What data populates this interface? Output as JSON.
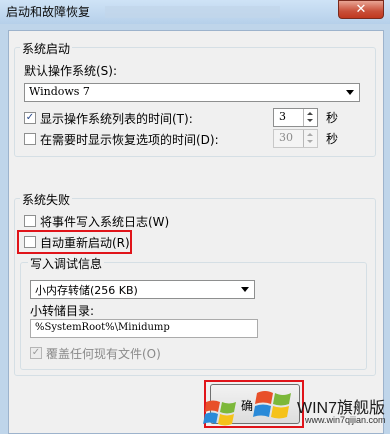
{
  "window": {
    "title": "启动和故障恢复",
    "close_glyph": "✕"
  },
  "startup": {
    "group_title": "系统启动",
    "default_os_label": "默认操作系统(S):",
    "default_os_value": "Windows 7",
    "show_os_list": {
      "label": "显示操作系统列表的时间(T):",
      "checked": true,
      "value": "3",
      "unit": "秒"
    },
    "show_recovery": {
      "label": "在需要时显示恢复选项的时间(D):",
      "checked": false,
      "value": "30",
      "unit": "秒"
    }
  },
  "failure": {
    "group_title": "系统失败",
    "write_event": {
      "label": "将事件写入系统日志(W)",
      "checked": false
    },
    "auto_restart": {
      "label": "自动重新启动(R)",
      "checked": false
    },
    "debug_group_title": "写入调试信息",
    "debug_type_value": "小内存转储(256 KB)",
    "dump_dir_label": "小转储目录:",
    "dump_dir_value": "%SystemRoot%\\Minidump",
    "overwrite": {
      "label": "覆盖任何现有文件(O)",
      "checked": true
    }
  },
  "buttons": {
    "ok_label": "确"
  },
  "watermark": {
    "text": "WIN7旗舰版",
    "url": "www.win7qijian.com"
  },
  "colors": {
    "highlight_border": "#e0141a"
  }
}
